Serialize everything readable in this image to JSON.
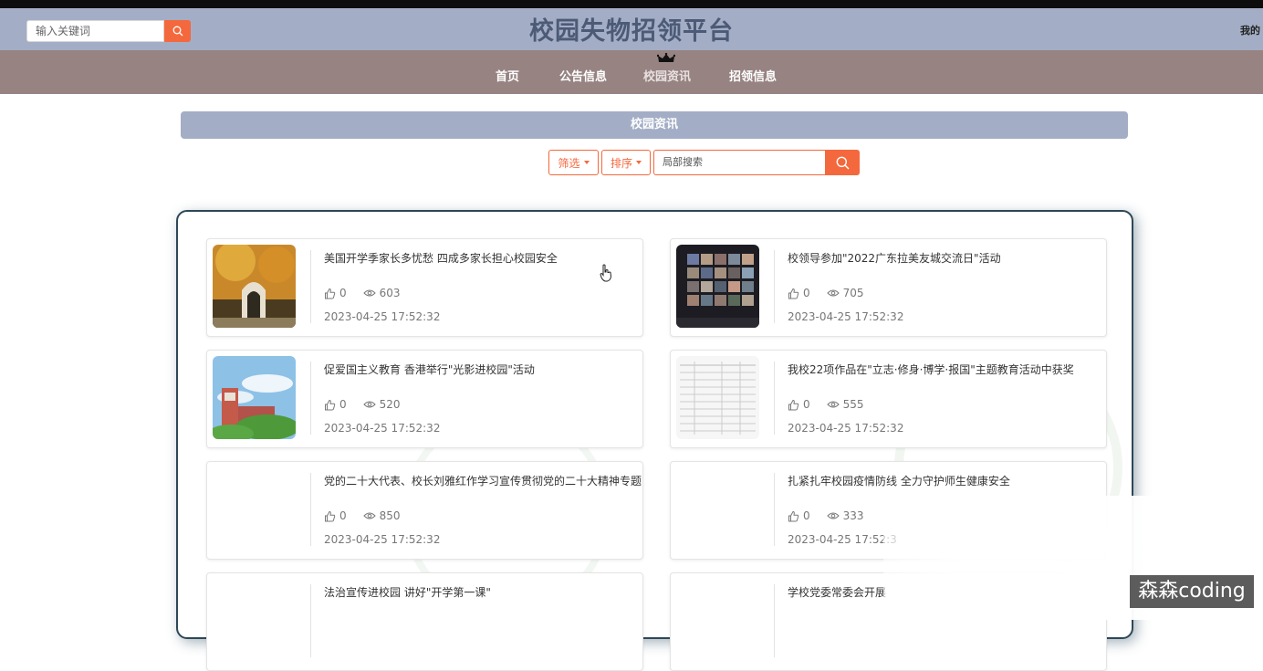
{
  "header": {
    "search_placeholder": "输入关键词",
    "title": "校园失物招领平台",
    "my_link": "我的"
  },
  "nav": {
    "items": [
      {
        "label": "首页"
      },
      {
        "label": "公告信息"
      },
      {
        "label": "校园资讯",
        "active": true
      },
      {
        "label": "招领信息"
      }
    ]
  },
  "section": {
    "title": "校园资讯",
    "filter_label": "筛选",
    "sort_label": "排序",
    "local_search_placeholder": "局部搜索"
  },
  "news": [
    {
      "title": "美国开学季家长多忧愁 四成多家长担心校园安全",
      "likes": "0",
      "views": "603",
      "date": "2023-04-25 17:52:32",
      "thumb": "autumn-campus-gate"
    },
    {
      "title": "校领导参加\"2022广东拉美友城交流日\"活动",
      "likes": "0",
      "views": "705",
      "date": "2023-04-25 17:52:32",
      "thumb": "video-conference"
    },
    {
      "title": "促爱国主义教育 香港举行\"光影进校园\"活动",
      "likes": "0",
      "views": "520",
      "date": "2023-04-25 17:52:32",
      "thumb": "clock-tower"
    },
    {
      "title": "我校22项作品在\"立志·修身·博学·报国\"主题教育活动中获奖",
      "likes": "0",
      "views": "555",
      "date": "2023-04-25 17:52:32",
      "thumb": "document-table"
    },
    {
      "title": "党的二十大代表、校长刘雅红作学习宣传贯彻党的二十大精神专题",
      "likes": "0",
      "views": "850",
      "date": "2023-04-25 17:52:32",
      "thumb": ""
    },
    {
      "title": "扎紧扎牢校园疫情防线 全力守护师生健康安全",
      "likes": "0",
      "views": "333",
      "date": "2023-04-25 17:52:3",
      "thumb": ""
    },
    {
      "title": "法治宣传进校园 讲好\"开学第一课\"",
      "likes": "",
      "views": "",
      "date": "",
      "thumb": ""
    },
    {
      "title": "学校党委常委会开展",
      "likes": "",
      "views": "",
      "date": "",
      "thumb": ""
    }
  ],
  "watermark": "森森coding",
  "colors": {
    "header_bg": "#a3aec6",
    "nav_bg": "#978382",
    "accent": "#f4683d",
    "title_text": "#4d5a76",
    "panel_border": "#2d4856"
  }
}
